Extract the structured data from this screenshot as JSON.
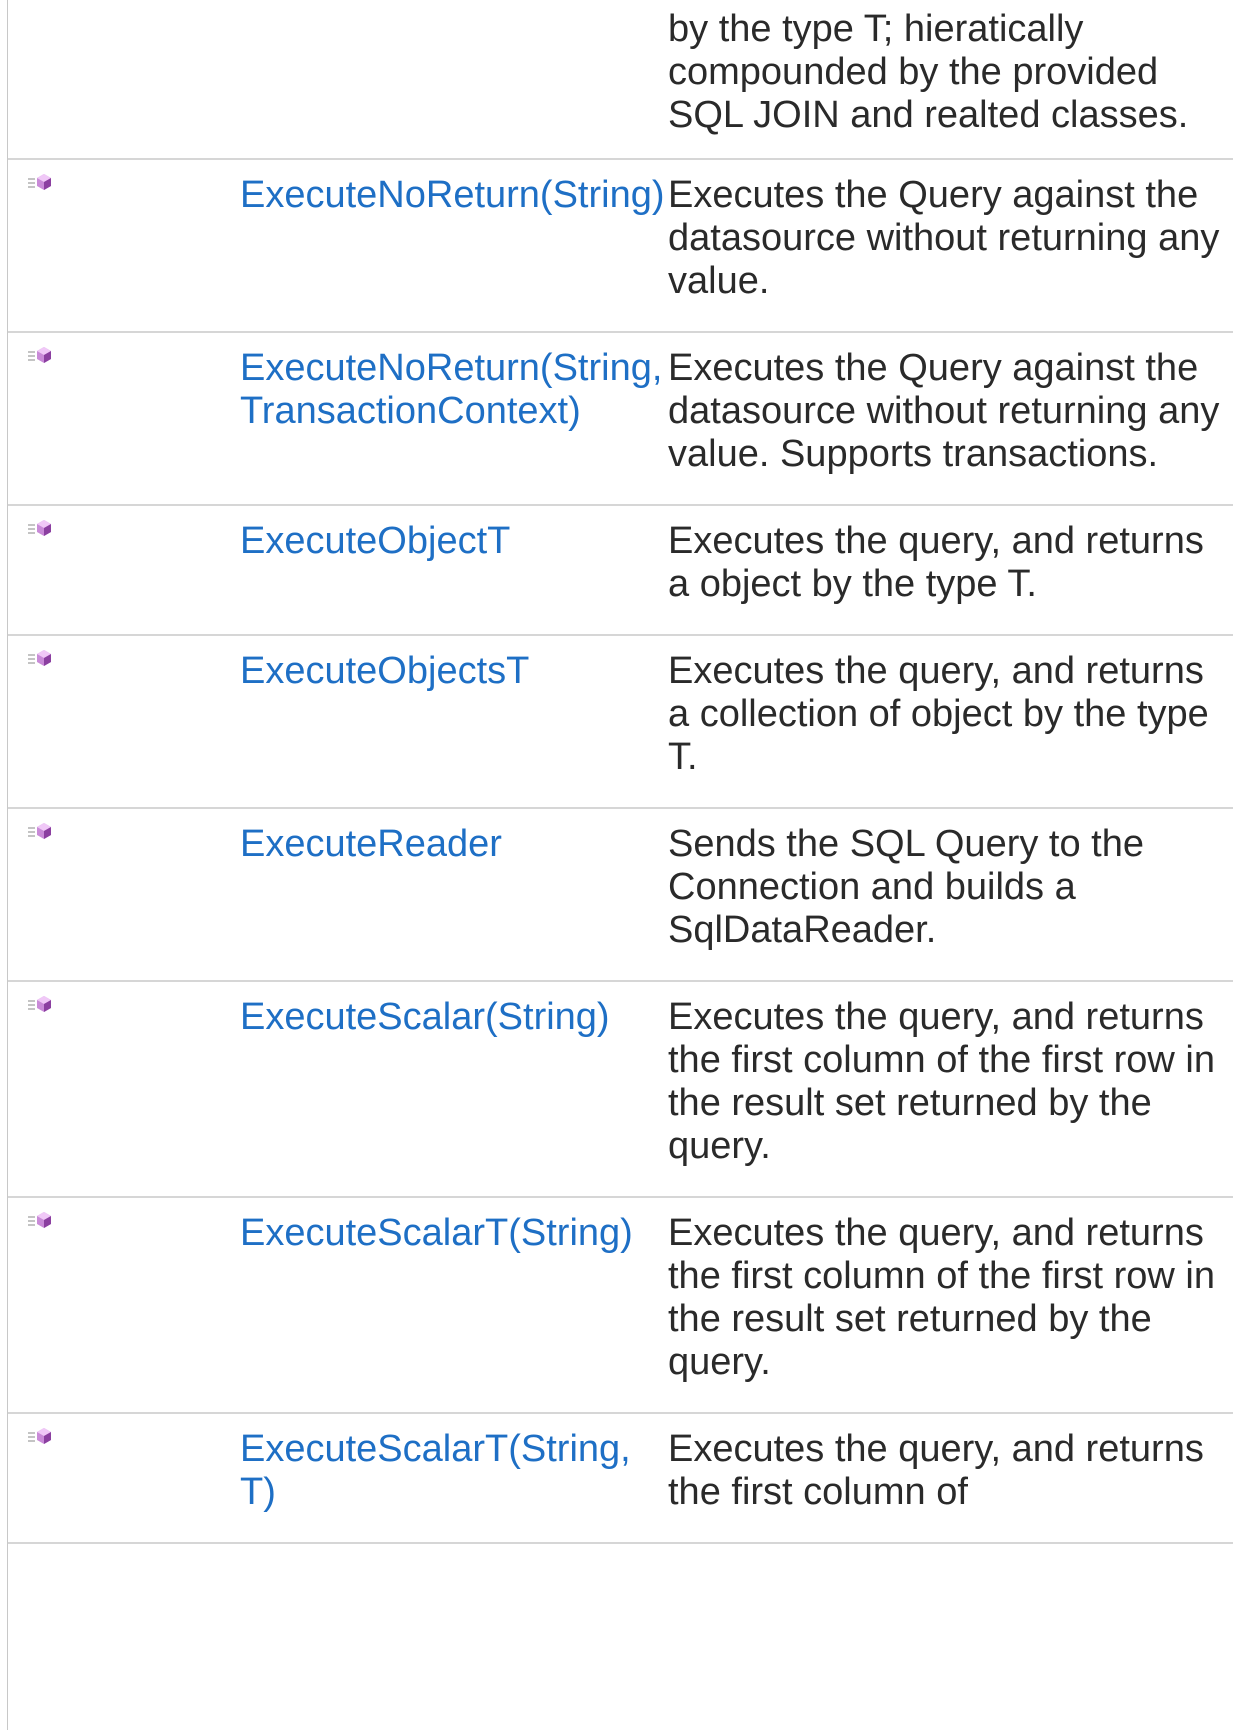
{
  "members": [
    {
      "name": "",
      "description": "by the type T; hieratically compounded by the provided SQL JOIN and realted classes.",
      "icon": null
    },
    {
      "name": "ExecuteNoReturn(String)",
      "description": "Executes the Query against the datasource without returning any value.",
      "icon": "public-method-icon"
    },
    {
      "name": "ExecuteNoReturn(String, TransactionContext)",
      "description": "Executes the Query against the datasource without returning any value. Supports transactions.",
      "icon": "public-method-icon"
    },
    {
      "name": "ExecuteObjectT",
      "description": "Executes the query, and returns a object by the type T.",
      "icon": "public-method-icon"
    },
    {
      "name": "ExecuteObjectsT",
      "description": "Executes the query, and returns a collection of object by the type T.",
      "icon": "public-method-icon"
    },
    {
      "name": "ExecuteReader",
      "description": "Sends the SQL Query to the Connection and builds a SqlDataReader.",
      "icon": "public-method-icon"
    },
    {
      "name": "ExecuteScalar(String)",
      "description": "Executes the query, and returns the first column of the first row in the result set returned by the query.",
      "icon": "public-method-icon"
    },
    {
      "name": "ExecuteScalarT(String)",
      "description": "Executes the query, and returns the first column of the first row in the result set returned by the query.",
      "icon": "public-method-icon"
    },
    {
      "name": "ExecuteScalarT(String, T)",
      "description": "Executes the query, and returns the first column of",
      "icon": "public-method-icon"
    }
  ],
  "colors": {
    "link": "#1e6fc5",
    "text": "#2a2a2a",
    "divider": "#d6d6d6"
  }
}
